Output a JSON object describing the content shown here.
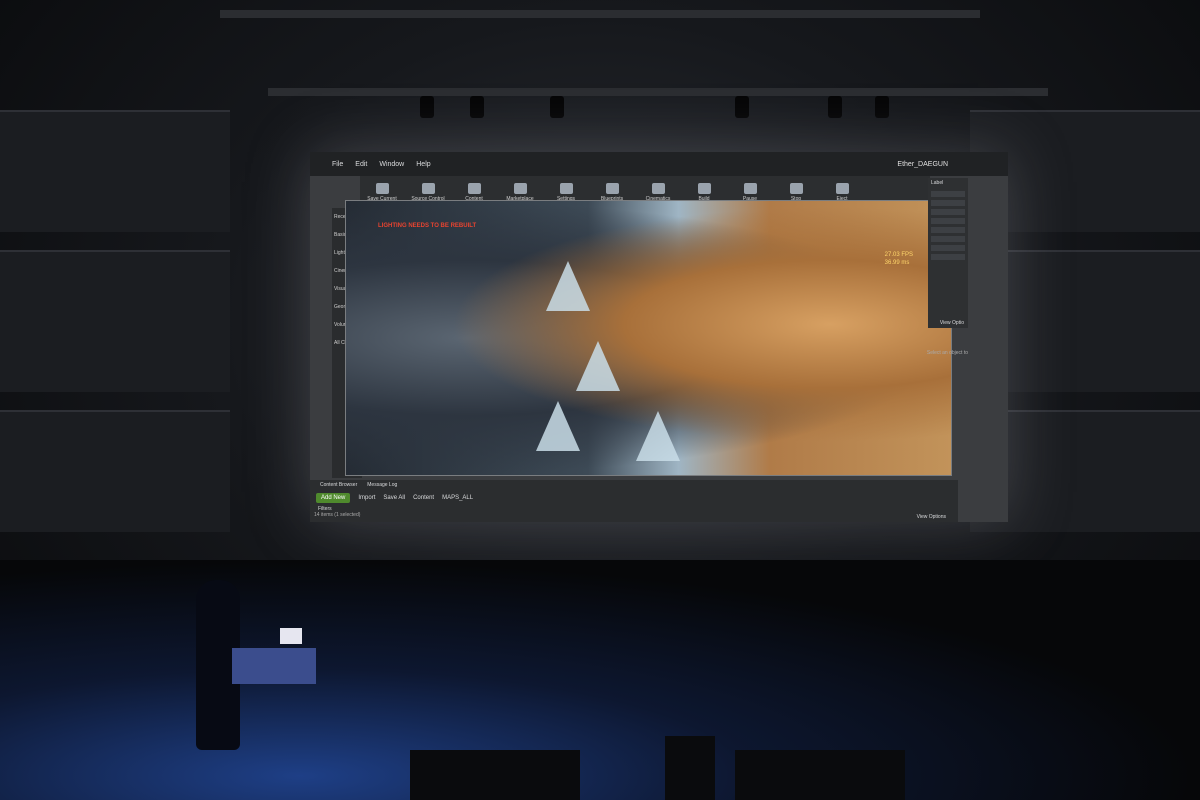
{
  "editor": {
    "menu": [
      "File",
      "Edit",
      "Window",
      "Help"
    ],
    "project": "Ether_DAEGUN",
    "toolbar": [
      "Save Current",
      "Source Control",
      "Content",
      "Marketplace",
      "Settings",
      "Blueprints",
      "Cinematics",
      "Build",
      "Pause",
      "Stop",
      "Eject"
    ],
    "modes": [
      "Recently P",
      "Basic",
      "Lights",
      "Cinematic",
      "Visual Effe",
      "Geometry",
      "Volumes",
      "All Classes"
    ],
    "warning": "LIGHTING NEEDS TO BE REBUILT",
    "fps": "27.03 FPS",
    "ms": "36.99 ms",
    "outliner_label": "Label",
    "view_options": "View Optio",
    "details_hint": "Select an object to",
    "content_tabs": [
      "Content Browser",
      "Message Log"
    ],
    "add_new": "Add New",
    "import": "Import",
    "save_all": "Save All",
    "path": [
      "Content",
      "MAPS_ALL"
    ],
    "filters": "Filters",
    "item_count": "14 items (1 selected)",
    "view_options_bottom": "View Options"
  }
}
